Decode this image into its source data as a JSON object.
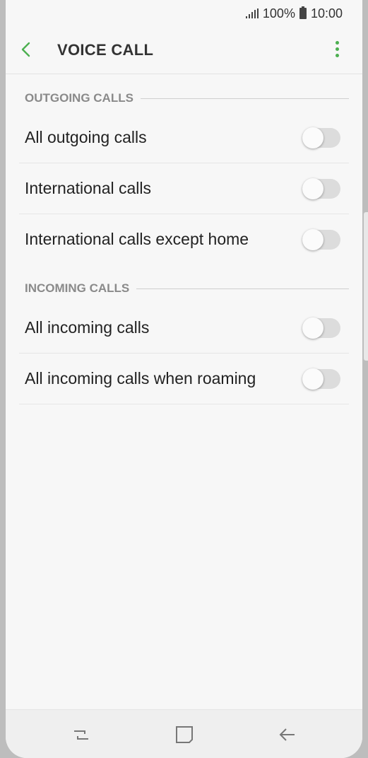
{
  "status_bar": {
    "battery": "100%",
    "time": "10:00"
  },
  "header": {
    "title": "VOICE CALL",
    "back_icon": "back-arrow-icon",
    "menu_icon": "more-options-icon"
  },
  "sections": [
    {
      "title": "OUTGOING CALLS",
      "items": [
        {
          "label": "All outgoing calls",
          "enabled": false
        },
        {
          "label": "International calls",
          "enabled": false
        },
        {
          "label": "International calls except home",
          "enabled": false
        }
      ]
    },
    {
      "title": "INCOMING CALLS",
      "items": [
        {
          "label": "All incoming calls",
          "enabled": false
        },
        {
          "label": "All incoming calls when roaming",
          "enabled": false
        }
      ]
    }
  ],
  "nav_bar": {
    "recent_icon": "recent-apps-icon",
    "home_icon": "home-icon",
    "back_icon": "back-icon"
  },
  "colors": {
    "accent": "#4caf50",
    "background": "#f7f7f7",
    "toggle_off": "#dcdcdc"
  }
}
